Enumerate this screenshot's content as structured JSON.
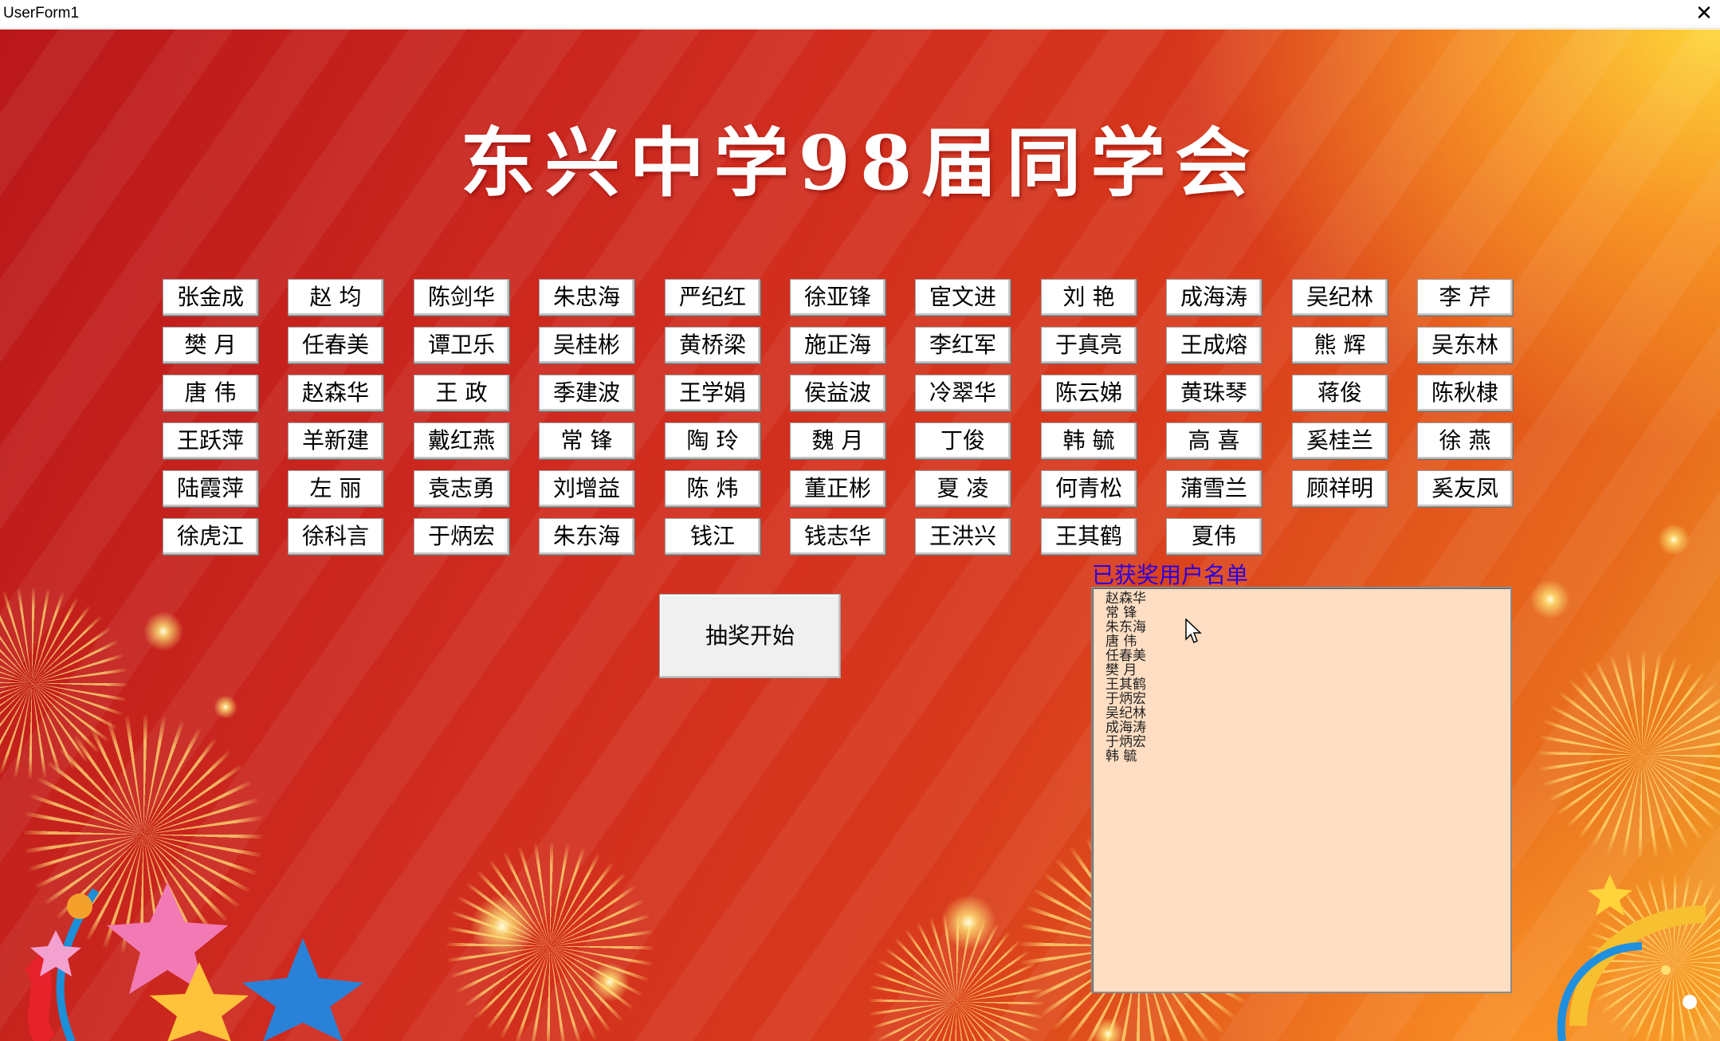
{
  "window": {
    "title": "UserForm1",
    "close_glyph": "✕"
  },
  "heading": "东兴中学98届同学会",
  "names": [
    [
      "张金成",
      "赵 均",
      "陈剑华",
      "朱忠海",
      "严纪红",
      "徐亚锋",
      "宦文进",
      "刘 艳",
      "成海涛",
      "吴纪林",
      "李 芹"
    ],
    [
      "樊 月",
      "任春美",
      "谭卫乐",
      "吴桂彬",
      "黄桥梁",
      "施正海",
      "李红军",
      "于真亮",
      "王成熔",
      "熊 辉",
      "吴东林"
    ],
    [
      "唐 伟",
      "赵森华",
      "王 政",
      "季建波",
      "王学娟",
      "侯益波",
      "冷翠华",
      "陈云娣",
      "黄珠琴",
      "蒋俊",
      "陈秋棣"
    ],
    [
      "王跃萍",
      "羊新建",
      "戴红燕",
      "常 锋",
      "陶 玲",
      "魏 月",
      "丁俊",
      "韩 毓",
      "高 喜",
      "奚桂兰",
      "徐 燕"
    ],
    [
      "陆霞萍",
      "左 丽",
      "袁志勇",
      "刘增益",
      "陈 炜",
      "董正彬",
      "夏 凌",
      "何青松",
      "蒲雪兰",
      "顾祥明",
      "奚友凤"
    ],
    [
      "徐虎江",
      "徐科言",
      "于炳宏",
      "朱东海",
      "钱江",
      "钱志华",
      "王洪兴",
      "王其鹤",
      "夏伟"
    ]
  ],
  "start_button": "抽奖开始",
  "winners": {
    "label": "已获奖用户名单",
    "items": [
      "赵森华",
      "常 锋",
      "朱东海",
      "唐 伟",
      "任春美",
      "樊 月",
      "王其鹤",
      "于炳宏",
      "吴纪林",
      "成海涛",
      "于炳宏",
      "韩 毓"
    ]
  },
  "icons": {
    "close": "close-icon",
    "cursor": "mouse-pointer-icon"
  },
  "colors": {
    "background": "#d02a1e",
    "winners_box": "#ffdec3",
    "winners_label": "#2a00e0"
  }
}
